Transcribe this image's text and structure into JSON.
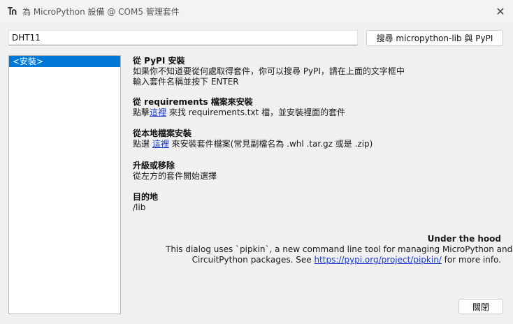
{
  "window": {
    "title": "為 MicroPython 設備 @ COM5 管理套件",
    "close_symbol": "✕",
    "icons": [
      "thonny-app-icon",
      "close-icon"
    ]
  },
  "search": {
    "value": "DHT11",
    "button_label": "搜尋 micropython-lib 與 PyPI"
  },
  "package_list": {
    "items": [
      "<安裝>"
    ],
    "selected_index": 0
  },
  "sections": {
    "pypi": {
      "heading": "從 PyPI 安裝",
      "line1": "如果你不知道要從何處取得套件，你可以搜尋 PyPI，請在上面的文字框中",
      "line2": "輸入套件名稱並按下 ENTER"
    },
    "requirements": {
      "heading": "從 requirements 檔案來安裝",
      "prefix": "點擊",
      "link": "這裡",
      "suffix": " 來找 requirements.txt 檔，並安裝裡面的套件"
    },
    "local": {
      "heading": "從本地檔案安裝",
      "prefix": "點選 ",
      "link": "這裡",
      "suffix": " 來安裝套件檔案(常見副檔名為 .whl  .tar.gz  或是 .zip)"
    },
    "upgrade": {
      "heading": "升級或移除",
      "text": "從左方的套件開始選擇"
    },
    "target": {
      "heading": "目的地",
      "text": "/lib"
    }
  },
  "under_the_hood": {
    "heading": "Under the hood",
    "line1": "This dialog uses `pipkin`, a new command line tool for managing MicroPython and",
    "line2_prefix": "CircuitPython packages. See ",
    "link": "https://pypi.org/project/pipkin/",
    "line2_suffix": " for more info."
  },
  "footer": {
    "close_label": "關閉"
  }
}
